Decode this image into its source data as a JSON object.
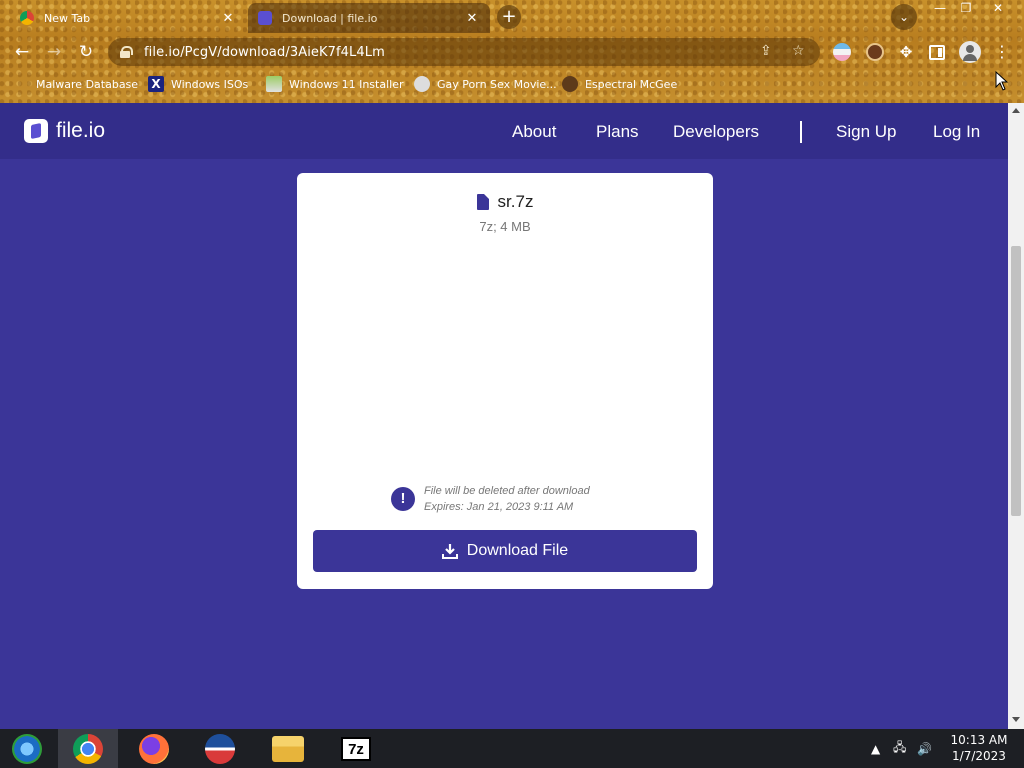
{
  "browser": {
    "tabs": [
      {
        "label": "New Tab",
        "close": "✕"
      },
      {
        "label": "Download | file.io",
        "close": "✕"
      }
    ],
    "new_tab": "+",
    "tab_search": "⌄",
    "window_controls": {
      "minimize": "—",
      "maximize": "❐",
      "close": "✕"
    },
    "url": "file.io/PcgV/download/3AieK7f4L4Lm",
    "bookmarks": [
      {
        "label": "Malware Database",
        "icon": "malware-db-icon"
      },
      {
        "label": "Windows ISOs",
        "icon": "x-icon"
      },
      {
        "label": "Windows 11 Installer",
        "icon": "image-icon"
      },
      {
        "label": "Gay Porn Sex Movie...",
        "icon": "site-icon"
      },
      {
        "label": "Espectral McGee",
        "icon": "face-icon"
      }
    ]
  },
  "site": {
    "logo_text": "file.io",
    "nav": {
      "about": "About",
      "plans": "Plans",
      "developers": "Developers",
      "sign_up": "Sign Up",
      "log_in": "Log In"
    }
  },
  "file": {
    "name": "sr.7z",
    "meta": "7z; 4 MB",
    "notice_line1": "File will be deleted after download",
    "notice_line2": "Expires: Jan 21, 2023 9:11 AM",
    "info_symbol": "!",
    "download_label": "Download File"
  },
  "taskbar": {
    "clock_time": "10:13 AM",
    "clock_date": "1/7/2023",
    "items": [
      "media-center-icon",
      "chrome-icon",
      "firefox-icon",
      "obama-logo-icon",
      "file-explorer-icon",
      "7zip-icon"
    ],
    "seven_zip_label": "7z"
  },
  "colors": {
    "brand": "#3b3598",
    "header": "#332d8a"
  }
}
